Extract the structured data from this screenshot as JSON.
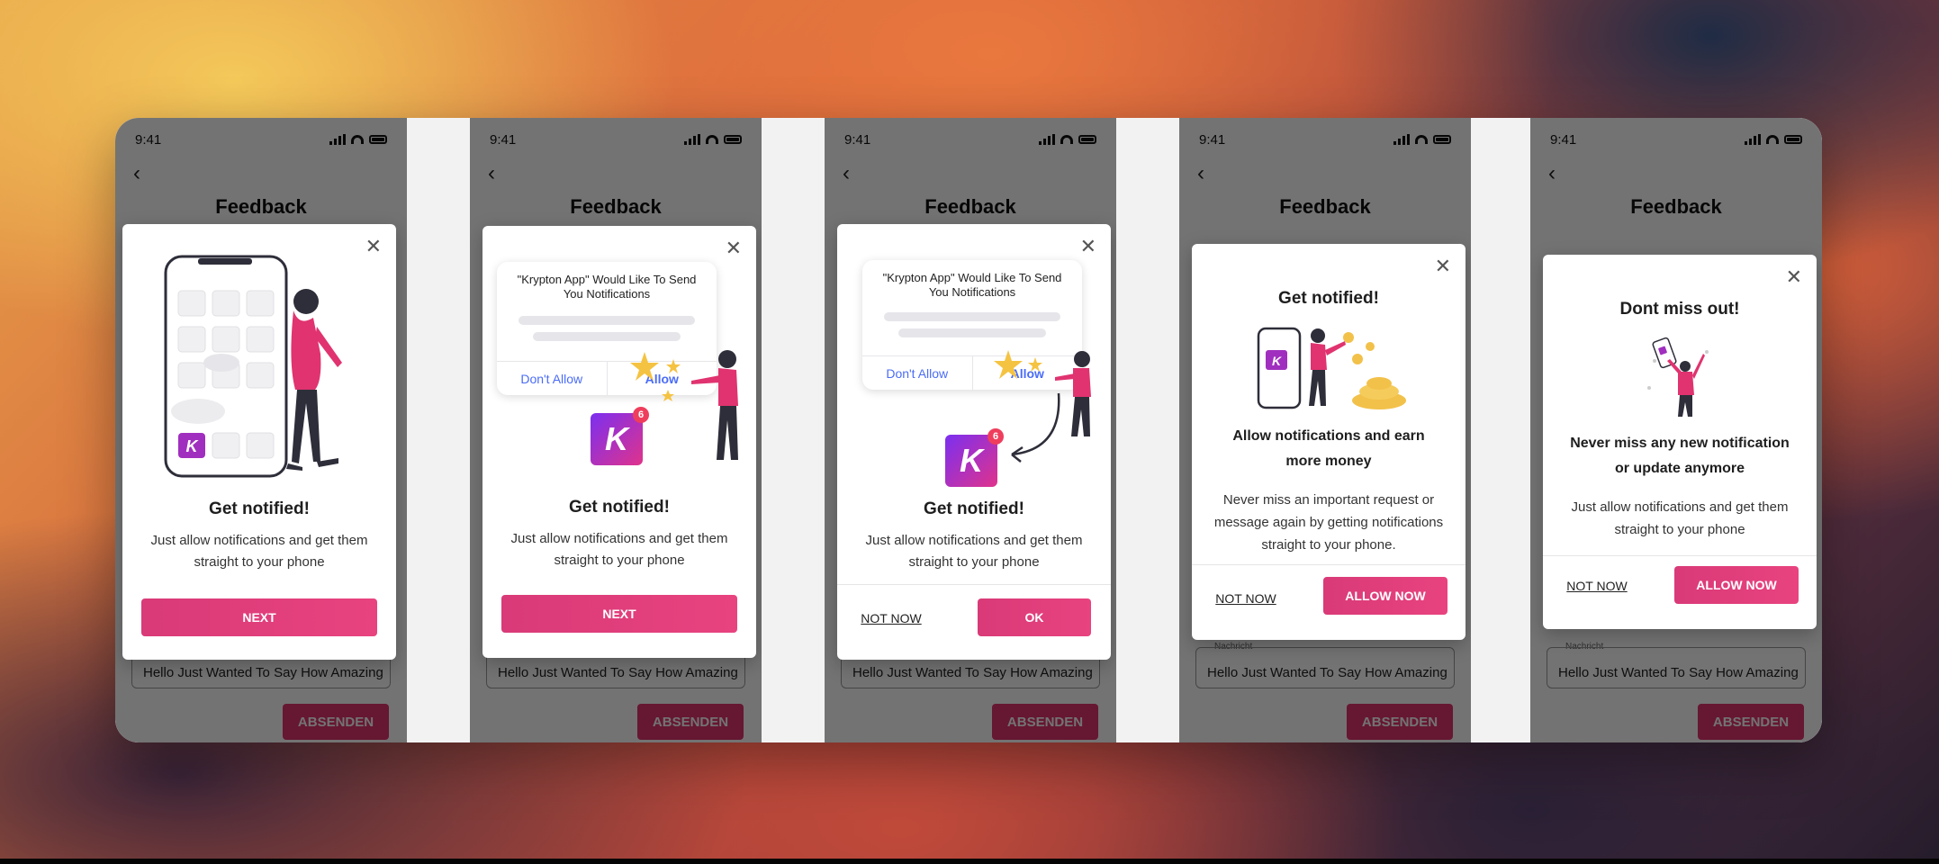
{
  "screen": {
    "time": "9:41",
    "page_title": "Feedback",
    "field_label": "Nachricht",
    "field_value": "Hello Just Wanted To Say How Amazing",
    "submit_label": "ABSENDEN"
  },
  "modals": [
    {
      "title": "Get notified!",
      "text": "Just allow notifications and get them straight to your phone",
      "primary": "NEXT"
    },
    {
      "prompt_title": "\"Krypton App\" Would Like To Send You Notifications",
      "dont_allow": "Don't Allow",
      "allow": "Allow",
      "badge_letter": "K",
      "badge_count": "6",
      "title": "Get notified!",
      "text": "Just allow notifications and get them straight to your phone",
      "primary": "NEXT"
    },
    {
      "prompt_title": "\"Krypton App\" Would Like To Send You Notifications",
      "dont_allow": "Don't Allow",
      "allow": "Allow",
      "badge_letter": "K",
      "badge_count": "6",
      "title": "Get notified!",
      "text": "Just allow notifications and get them straight to your phone",
      "secondary": "NOT NOW",
      "primary": "OK"
    },
    {
      "title": "Get notified!",
      "subtitle": "Allow notifications and earn more money",
      "text": "Never miss an important request or message again by getting notifications straight to your phone.",
      "secondary": "NOT NOW",
      "primary": "ALLOW NOW"
    },
    {
      "title": "Dont miss out!",
      "subtitle": "Never miss any new notification or update anymore",
      "text": "Just allow notifications and get them straight to your phone",
      "secondary": "NOT NOW",
      "primary": "ALLOW NOW"
    }
  ],
  "colors": {
    "accent": "#e2336f",
    "prompt_link": "#4a6cf7",
    "badge_start": "#7b2ff0",
    "badge_end": "#e0338b"
  }
}
